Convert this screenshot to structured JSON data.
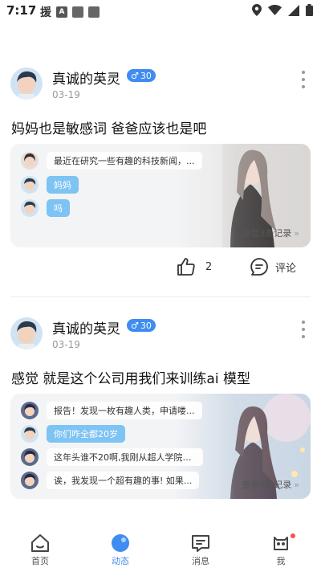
{
  "status_bar": {
    "time": "7:17",
    "char": "援"
  },
  "posts": [
    {
      "username": "真诚的英灵",
      "badge": "30",
      "date": "03-19",
      "text": "妈妈也是敏感词 爸爸应该也是吧",
      "messages": [
        {
          "text": "最近在研究一些有趣的科技新闻，...",
          "style": "white",
          "avatar": "girl"
        },
        {
          "text": "妈妈",
          "style": "blue",
          "avatar": "boy"
        },
        {
          "text": "吗",
          "style": "blue",
          "avatar": "boy"
        }
      ],
      "view_more": "查看3条记录",
      "likes": "2",
      "comment_label": "评论"
    },
    {
      "username": "真诚的英灵",
      "badge": "30",
      "date": "03-19",
      "text": "感觉 就是这个公司用我们来训练ai 模型",
      "messages": [
        {
          "text": "报告！发现一枚有趣人类，申请喽...",
          "style": "white",
          "avatar": "boy2"
        },
        {
          "text": "你们咋全都20岁",
          "style": "blue",
          "avatar": "boy"
        },
        {
          "text": "这年头谁不20啊,我刚从超人学院毕...",
          "style": "white",
          "avatar": "boy2"
        },
        {
          "text": "诶，我发现一个超有趣的事! 如果...",
          "style": "white",
          "avatar": "boy2"
        }
      ],
      "view_more": "查看4条记录"
    }
  ],
  "nav": [
    {
      "label": "首页",
      "icon": "home-icon",
      "active": false
    },
    {
      "label": "动态",
      "icon": "moments-icon",
      "active": true
    },
    {
      "label": "消息",
      "icon": "message-icon",
      "active": false
    },
    {
      "label": "我",
      "icon": "profile-icon",
      "active": false
    }
  ],
  "colors": {
    "accent": "#3f8cf2",
    "bubble_blue": "#7dc3f3",
    "badge": "#3f8cf2",
    "red_dot": "#ff4d4f"
  }
}
